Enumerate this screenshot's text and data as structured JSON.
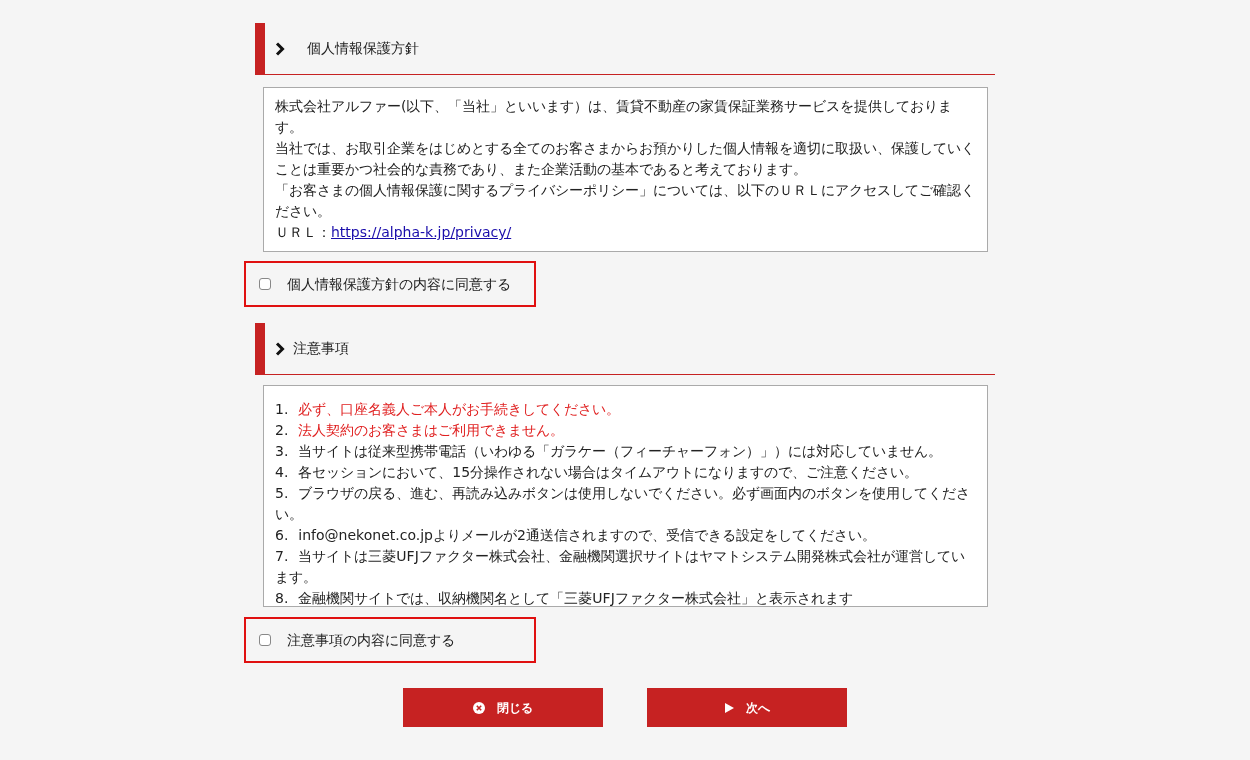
{
  "policy": {
    "heading": "個人情報保護方針",
    "paragraphs": [
      "株式会社アルファー(以下、「当社」といいます）は、賃貸不動産の家賃保証業務サービスを提供しております。",
      "当社では、お取引企業をはじめとする全てのお客さまからお預かりした個人情報を適切に取扱い、保護していくことは重要かつ社会的な責務であり、また企業活動の基本であると考えております。",
      "「お客さまの個人情報保護に関するプライバシーポリシー」については、以下のＵＲＬにアクセスしてご確認ください。"
    ],
    "url_label": "ＵＲＬ：",
    "url": "https://alpha-k.jp/privacy/",
    "agree": {
      "label": "個人情報保護方針の内容に同意する",
      "checked": false
    }
  },
  "notices": {
    "heading": "注意事項",
    "items": [
      {
        "number": "1.",
        "text": "必ず、口座名義人ご本人がお手続きしてください。",
        "emphasis": true
      },
      {
        "number": "2.",
        "text": "法人契約のお客さまはご利用できません。",
        "emphasis": true
      },
      {
        "number": "3.",
        "text": "当サイトは従来型携帯電話（いわゆる「ガラケー（フィーチャーフォン）」）には対応していません。",
        "emphasis": false
      },
      {
        "number": "4.",
        "text": "各セッションにおいて、15分操作されない場合はタイムアウトになりますので、ご注意ください。",
        "emphasis": false
      },
      {
        "number": "5.",
        "text": "ブラウザの戻る、進む、再読み込みボタンは使用しないでください。必ず画面内のボタンを使用してください。",
        "emphasis": false
      },
      {
        "number": "6.",
        "text": "info@nekonet.co.jpよりメールが2通送信されますので、受信できる設定をしてください。",
        "emphasis": false
      },
      {
        "number": "7.",
        "text": "当サイトは三菱UFJファクター株式会社、金融機関選択サイトはヤマトシステム開発株式会社が運営しています。",
        "emphasis": false
      },
      {
        "number": "8.",
        "text": "金融機関サイトでは、収納機関名として「三菱UFJファクター株式会社」と表示されます",
        "emphasis": false
      }
    ],
    "agree": {
      "label": "注意事項の内容に同意する",
      "checked": false
    }
  },
  "buttons": [
    {
      "kind": "close",
      "label": "閉じる"
    },
    {
      "kind": "next",
      "label": "次へ"
    }
  ]
}
